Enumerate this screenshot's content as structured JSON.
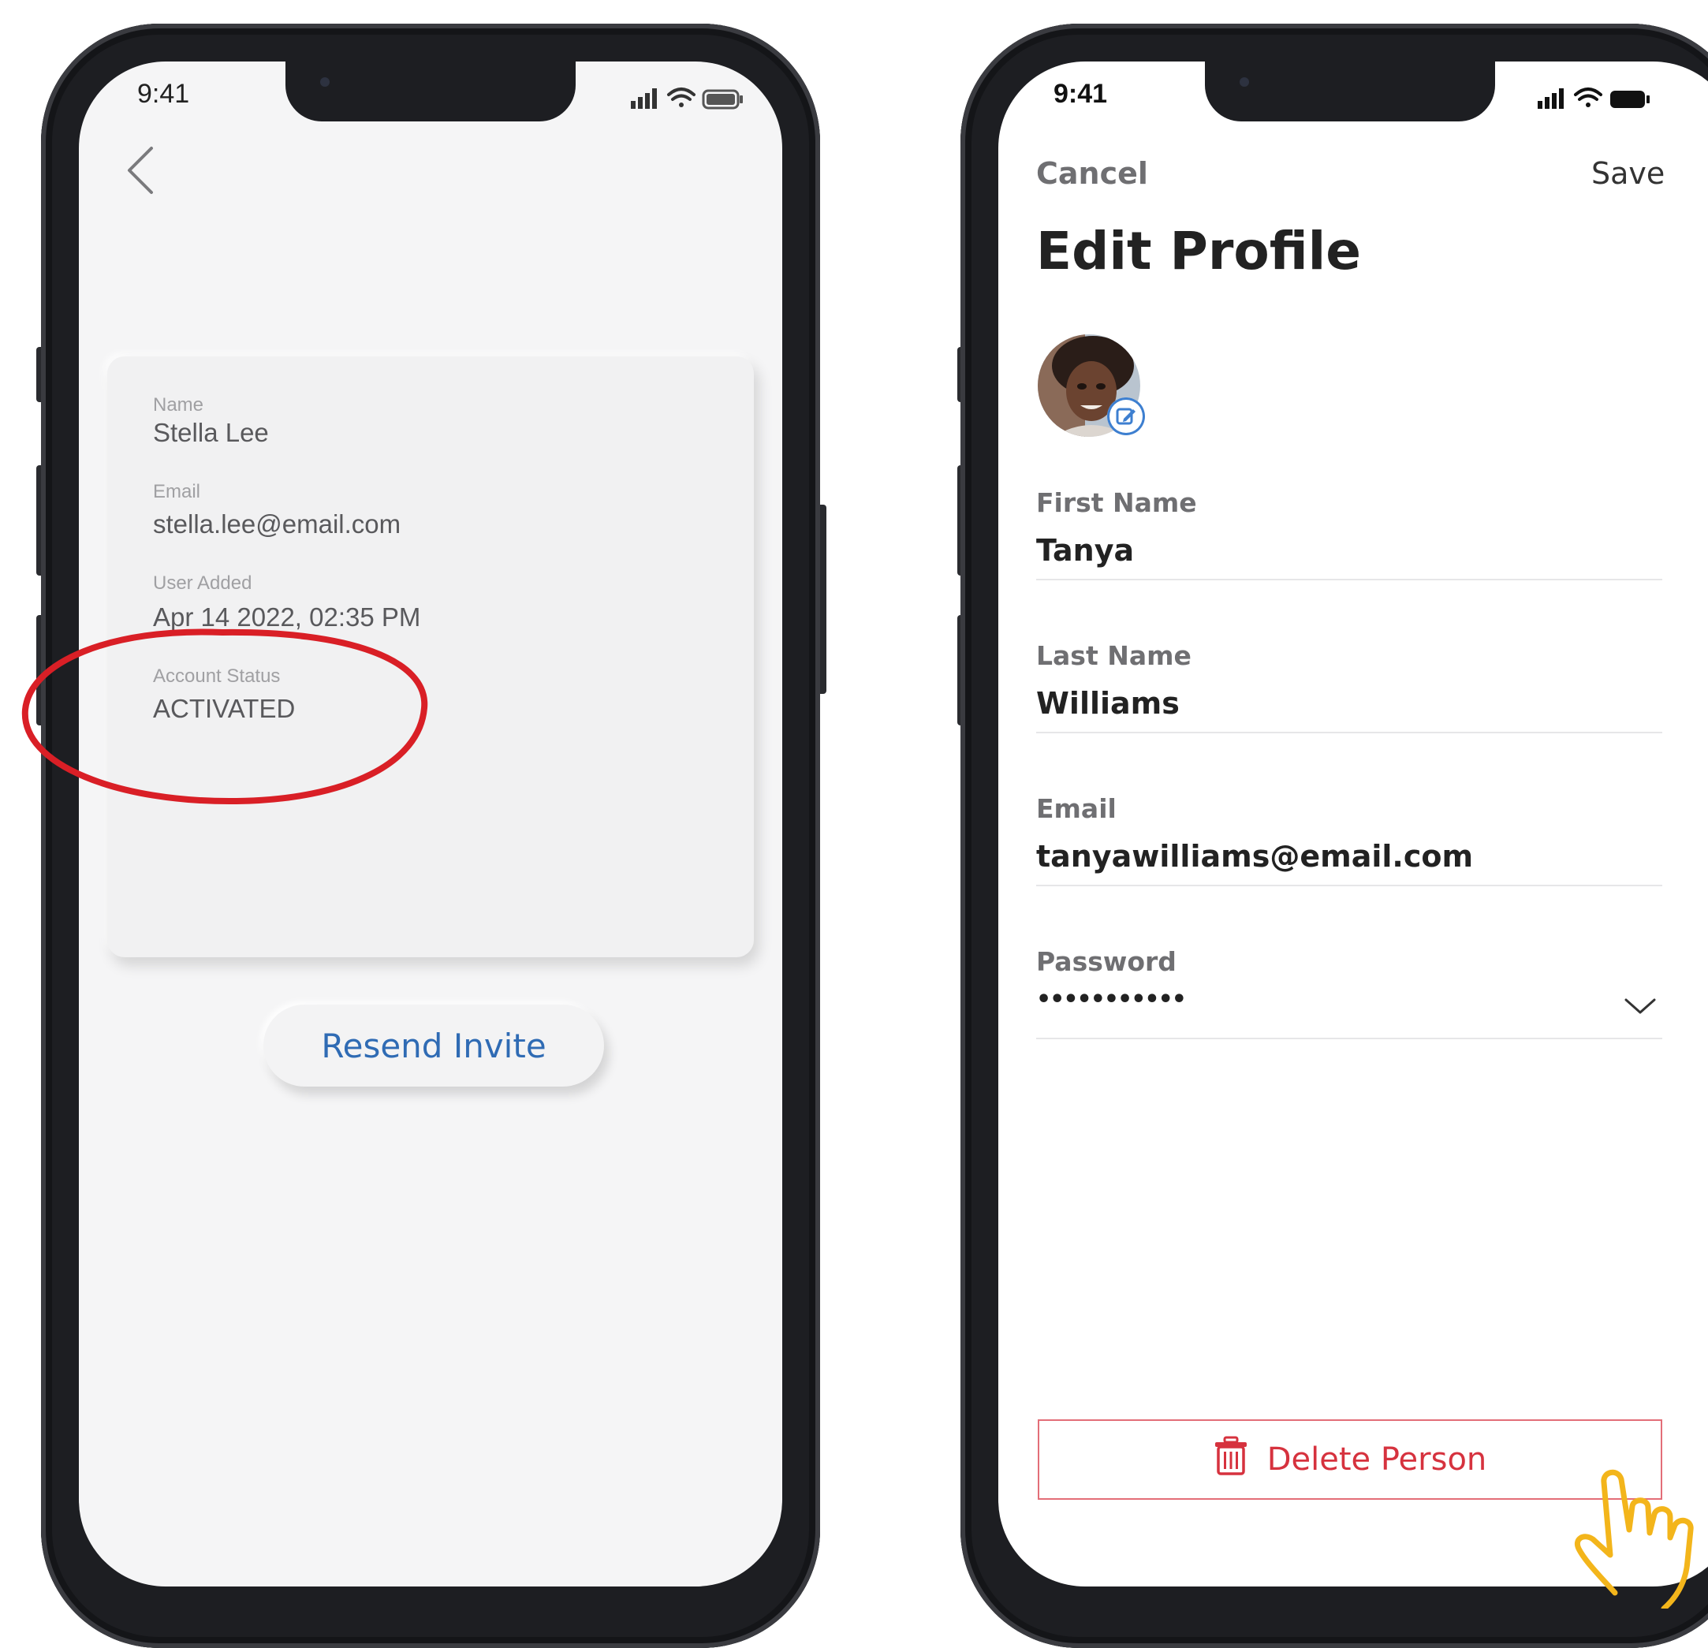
{
  "left_phone": {
    "status_time": "9:41",
    "card": {
      "name_label": "Name",
      "name_value": "Stella Lee",
      "email_label": "Email",
      "email_value": "stella.lee@email.com",
      "added_label": "User Added",
      "added_value": "Apr 14 2022, 02:35 PM",
      "status_label": "Account Status",
      "status_value": "ACTIVATED"
    },
    "resend_label": "Resend Invite"
  },
  "right_phone": {
    "status_time": "9:41",
    "cancel_label": "Cancel",
    "save_label": "Save",
    "title": "Edit Profile",
    "fields": [
      {
        "label": "First Name",
        "value": "Tanya"
      },
      {
        "label": "Last Name",
        "value": "Williams"
      },
      {
        "label": "Email",
        "value": "tanyawilliams@email.com"
      },
      {
        "label": "Password",
        "value": "•••••••••••"
      }
    ],
    "delete_label": "Delete Person"
  },
  "colors": {
    "link_blue": "#2f6bb4",
    "delete_red": "#d6323e",
    "annotation_red": "#d91f26",
    "hand_yellow": "#f3b51b"
  },
  "icons": [
    "back-chevron-icon",
    "signal-icon",
    "wifi-icon",
    "battery-icon",
    "edit-pencil-icon",
    "chevron-down-icon",
    "trash-icon",
    "pointing-hand-icon"
  ]
}
